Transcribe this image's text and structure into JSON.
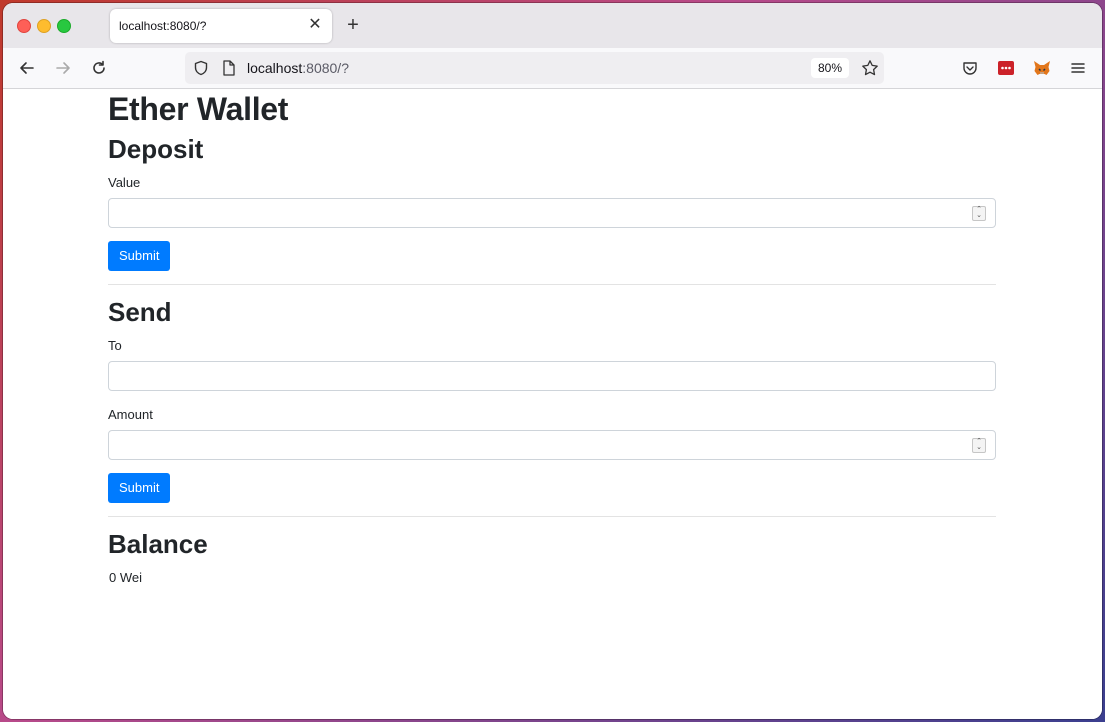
{
  "browser": {
    "tab_title": "localhost:8080/?",
    "url_host": "localhost",
    "url_rest": ":8080/?",
    "zoom": "80%",
    "colors": {
      "accent": "#007bff"
    }
  },
  "page": {
    "title": "Ether Wallet",
    "deposit": {
      "heading": "Deposit",
      "value_label": "Value",
      "value": "",
      "submit_label": "Submit"
    },
    "send": {
      "heading": "Send",
      "to_label": "To",
      "to_value": "",
      "amount_label": "Amount",
      "amount_value": "",
      "submit_label": "Submit"
    },
    "balance": {
      "heading": "Balance",
      "value": "0 Wei"
    }
  }
}
